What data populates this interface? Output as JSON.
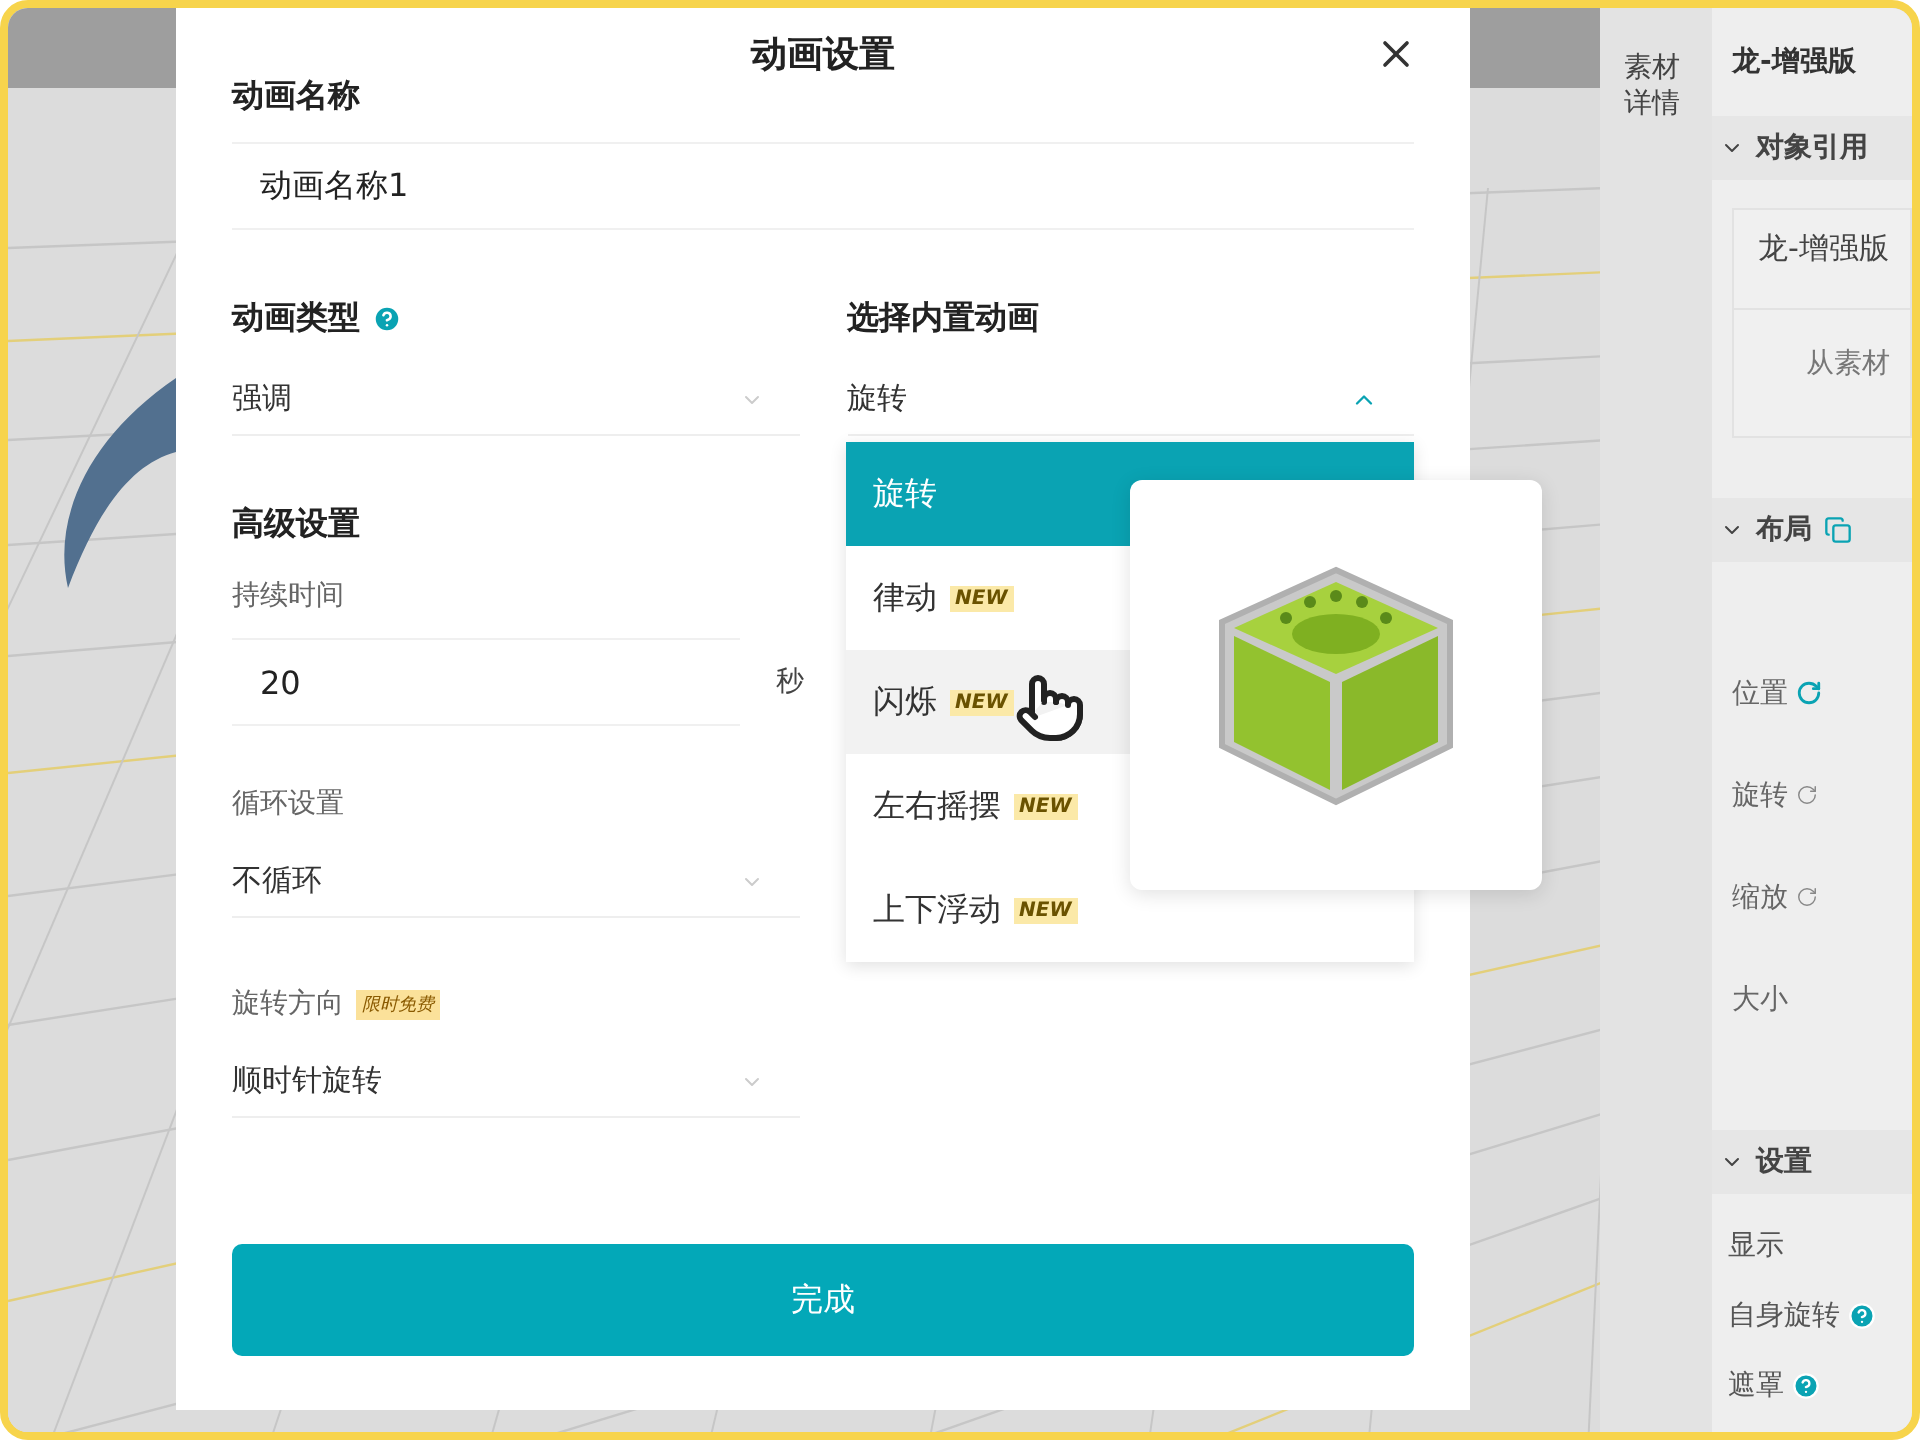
{
  "dialog": {
    "title": "动画设置",
    "name_field": {
      "label": "动画名称",
      "value": "动画名称1"
    },
    "type_field": {
      "label": "动画类型",
      "value": "强调"
    },
    "preset_field": {
      "label": "选择内置动画",
      "value": "旋转",
      "expanded": true
    },
    "options": [
      {
        "label": "旋转",
        "selected": true,
        "hovered": false
      },
      {
        "label": "律动",
        "badge": "NEW",
        "selected": false,
        "hovered": false
      },
      {
        "label": "闪烁",
        "badge": "NEW",
        "selected": false,
        "hovered": true
      },
      {
        "label": "左右摇摆",
        "badge": "NEW",
        "selected": false,
        "hovered": false
      },
      {
        "label": "上下浮动",
        "badge": "NEW",
        "selected": false,
        "hovered": false
      }
    ],
    "advanced": {
      "heading": "高级设置",
      "duration": {
        "label": "持续时间",
        "value": "20",
        "unit": "秒"
      },
      "loop": {
        "label": "循环设置",
        "value": "不循环"
      },
      "direction": {
        "label": "旋转方向",
        "tag": "限时免费",
        "value": "顺时针旋转"
      }
    },
    "done_button": "完成"
  },
  "side_panel": {
    "tab": "素材详情",
    "title": "龙-增强版",
    "reference": {
      "heading": "对象引用",
      "name": "龙-增强版",
      "action": "从素材"
    },
    "layout": {
      "heading": "布局",
      "rows": [
        {
          "label": "位置",
          "active": true
        },
        {
          "label": "旋转",
          "active": false
        },
        {
          "label": "缩放",
          "active": false
        },
        {
          "label": "大小"
        }
      ]
    },
    "settings": {
      "heading": "设置",
      "rows": [
        {
          "label": "显示"
        },
        {
          "label": "自身旋转",
          "help": true
        },
        {
          "label": "遮罩",
          "help": true
        }
      ]
    }
  }
}
